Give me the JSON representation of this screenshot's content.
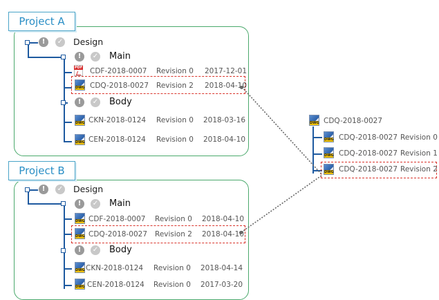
{
  "projects": [
    {
      "title": "Project A",
      "root": "Design",
      "groups": [
        {
          "label": "Main",
          "files": [
            {
              "name": "CDF-2018-0007",
              "revision": "Revision 0",
              "date": "2017-12-01",
              "icon": "pdf-icon"
            },
            {
              "name": "CDQ-2018-0027",
              "revision": "Revision 2",
              "date": "2018-04-10",
              "icon": "dwg-icon",
              "highlighted": true
            }
          ]
        },
        {
          "label": "Body",
          "files": [
            {
              "name": "CKN-2018-0124",
              "revision": "Revision 0",
              "date": "2018-03-16",
              "icon": "dwg-icon"
            },
            {
              "name": "CEN-2018-0124",
              "revision": "Revision 0",
              "date": "2018-04-10",
              "icon": "dwg-icon"
            }
          ]
        }
      ]
    },
    {
      "title": "Project B",
      "root": "Design",
      "groups": [
        {
          "label": "Main",
          "files": [
            {
              "name": "CDF-2018-0007",
              "revision": "Revision 0",
              "date": "2018-04-10",
              "icon": "dwg-icon"
            },
            {
              "name": "CDQ-2018-0027",
              "revision": "Revision 2",
              "date": "2018-04-10",
              "icon": "dwg-icon",
              "highlighted": true
            }
          ]
        },
        {
          "label": "Body",
          "files": [
            {
              "name": "CKN-2018-0124",
              "revision": "Revision 0",
              "date": "2018-04-14",
              "icon": "dwg-icon"
            },
            {
              "name": "CEN-2018-0124",
              "revision": "Revision 0",
              "date": "2017-03-20",
              "icon": "dwg-icon"
            }
          ]
        }
      ]
    }
  ],
  "shared_document": {
    "name": "CDQ-2018-0027",
    "revisions": [
      {
        "name": "CDQ-2018-0027",
        "revision": "Revision 0"
      },
      {
        "name": "CDQ-2018-0027",
        "revision": "Revision 1"
      },
      {
        "name": "CDQ-2018-0027",
        "revision": "Revision 2",
        "highlighted": true
      }
    ]
  },
  "colors": {
    "panel_border": "#4aa96c",
    "tab_text": "#2b8fc6",
    "tree_line": "#1e5aa0",
    "highlight": "#d9342b"
  }
}
